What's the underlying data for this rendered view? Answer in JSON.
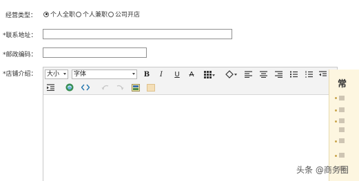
{
  "form": {
    "business_type_label": "经营类型：",
    "business_options": [
      {
        "label": "个人全职",
        "checked": true
      },
      {
        "label": "个人兼职",
        "checked": false
      },
      {
        "label": "公司开店",
        "checked": false
      }
    ],
    "address_label": "*联系地址：",
    "address_value": "",
    "zip_label": "*邮政编码：",
    "zip_value": "",
    "intro_label": "*店铺介绍："
  },
  "editor": {
    "font_size_select": "大小",
    "font_family_select": "字体",
    "buttons": {
      "bold": "B",
      "italic": "I",
      "underline": "U",
      "strikethrough": "A"
    },
    "icons": [
      "table-icon",
      "fill-color-icon",
      "align-left-icon",
      "align-center-icon",
      "align-right-icon",
      "unordered-list-icon",
      "ordered-list-icon",
      "indent-icon",
      "insert-link-icon",
      "source-code-icon",
      "undo-icon",
      "redo-icon",
      "insert-image-icon",
      "emoticon-icon"
    ]
  },
  "tip": {
    "title": "常"
  },
  "watermark": {
    "text": "头条 @商务圈"
  },
  "colors": {
    "tip_bg": "#fdf6e0",
    "tip_bullet": "#c9a44a",
    "toolbar_bg": "#f3f3f3"
  }
}
